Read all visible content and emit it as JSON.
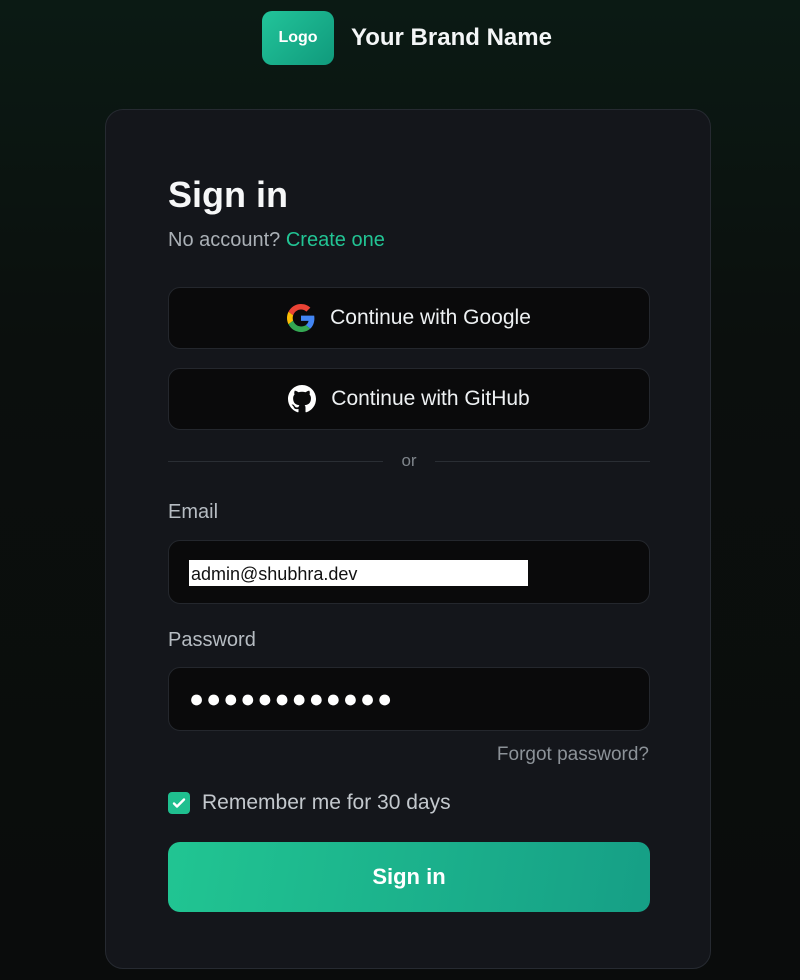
{
  "brand": {
    "logo_text": "Logo",
    "name": "Your Brand Name"
  },
  "form": {
    "title": "Sign in",
    "no_account_text": "No account?",
    "create_link": "Create one",
    "google_button": "Continue with Google",
    "github_button": "Continue with GitHub",
    "divider_text": "or",
    "email_label": "Email",
    "email_value": "admin@shubhra.dev",
    "password_label": "Password",
    "password_mask": "●●●●●●●●●●●●",
    "forgot_link": "Forgot password?",
    "remember_label": "Remember me for 30 days",
    "remember_checked": true,
    "submit_label": "Sign in"
  },
  "colors": {
    "accent": "#22c494",
    "card_bg": "#14161b",
    "input_bg": "#0a0a0b"
  },
  "icons": {
    "google": "google-icon",
    "github": "github-icon",
    "check": "check-icon"
  }
}
